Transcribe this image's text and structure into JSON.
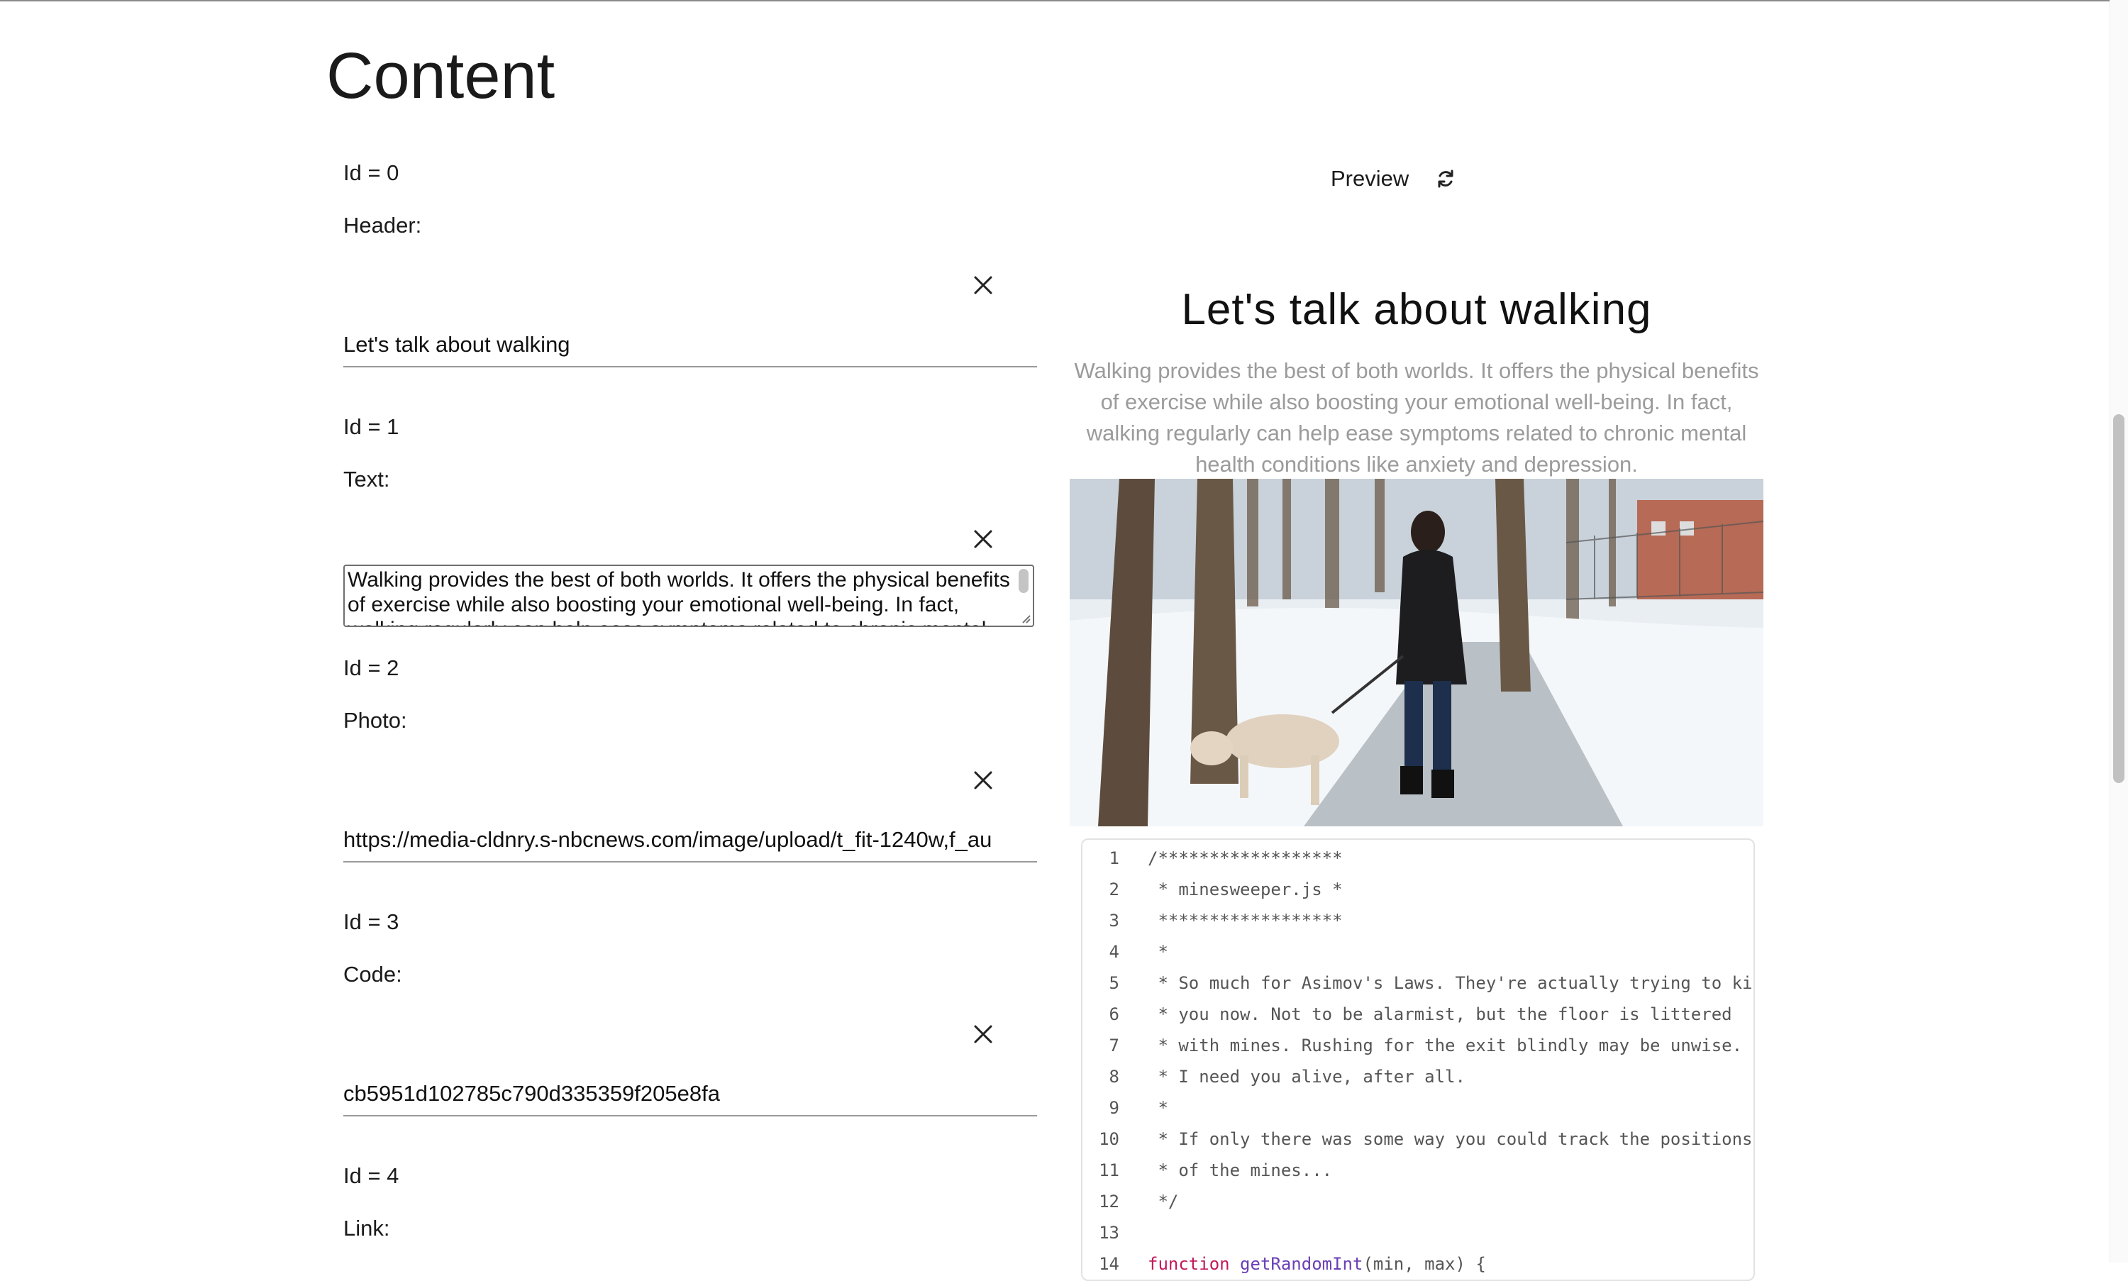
{
  "page": {
    "title": "Content"
  },
  "blocks": [
    {
      "id_label": "Id = 0",
      "type_label": "Header:",
      "value": "Let's talk about walking"
    },
    {
      "id_label": "Id = 1",
      "type_label": "Text:",
      "value": "Walking provides the best of both worlds. It offers the physical benefits of exercise while also boosting your emotional well-being. In fact, walking regularly can help ease symptoms related to chronic mental health conditions like anxiety and depression."
    },
    {
      "id_label": "Id = 2",
      "type_label": "Photo:",
      "value": "https://media-cldnry.s-nbcnews.com/image/upload/t_fit-1240w,f_au"
    },
    {
      "id_label": "Id = 3",
      "type_label": "Code:",
      "value": "cb5951d102785c790d335359f205e8fa"
    },
    {
      "id_label": "Id = 4",
      "type_label": "Link:"
    }
  ],
  "preview": {
    "label": "Preview",
    "refresh_icon": "refresh-icon",
    "header": "Let's talk about walking",
    "text": "Walking provides the best of both worlds. It offers the physical benefits of exercise while also boosting your emotional well-being. In fact, walking regularly can help ease symptoms related to chronic mental health conditions like anxiety and depression.",
    "code_lines": [
      {
        "n": "1",
        "text": "/******************"
      },
      {
        "n": "2",
        "text": " * minesweeper.js *"
      },
      {
        "n": "3",
        "text": " ******************"
      },
      {
        "n": "4",
        "text": " *"
      },
      {
        "n": "5",
        "text": " * So much for Asimov's Laws. They're actually trying to ki"
      },
      {
        "n": "6",
        "text": " * you now. Not to be alarmist, but the floor is littered"
      },
      {
        "n": "7",
        "text": " * with mines. Rushing for the exit blindly may be unwise."
      },
      {
        "n": "8",
        "text": " * I need you alive, after all."
      },
      {
        "n": "9",
        "text": " *"
      },
      {
        "n": "10",
        "text": " * If only there was some way you could track the positions"
      },
      {
        "n": "11",
        "text": " * of the mines..."
      },
      {
        "n": "12",
        "text": " */"
      },
      {
        "n": "13",
        "text": ""
      },
      {
        "n": "14",
        "kw": "function",
        "fn": "getRandomInt",
        "rest": "(min, max) {"
      }
    ]
  },
  "icons": {
    "close": "close-icon",
    "refresh": "refresh-icon"
  },
  "colors": {
    "muted_text": "#9b9b9b",
    "keyword": "#c2185b",
    "function": "#6a3fb5"
  }
}
